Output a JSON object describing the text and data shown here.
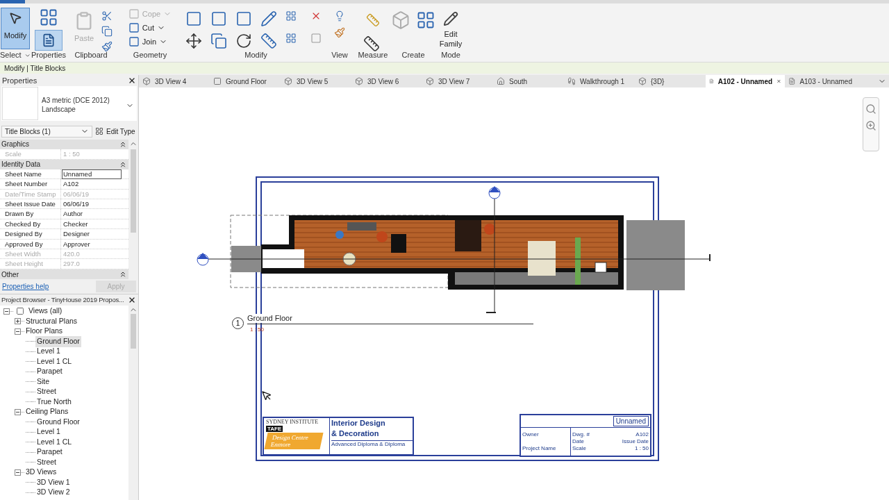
{
  "ribbon": {
    "groups": [
      {
        "label": "Select",
        "dropdown": true,
        "buttons": [
          {
            "label": "Modify",
            "kind": "large",
            "selected": true,
            "disabled": false
          }
        ]
      },
      {
        "label": "Properties"
      },
      {
        "label": "Clipboard",
        "buttons": [
          {
            "label": "Paste",
            "kind": "large",
            "selected": false,
            "disabled": true
          }
        ]
      },
      {
        "label": "Geometry",
        "buttons": [
          {
            "label": "Cope",
            "kind": "small",
            "selected": false,
            "disabled": true
          },
          {
            "label": "Cut",
            "kind": "small",
            "selected": false,
            "disabled": false
          },
          {
            "label": "Join",
            "kind": "small",
            "selected": false,
            "disabled": false
          }
        ]
      },
      {
        "label": "Modify"
      },
      {
        "label": "View"
      },
      {
        "label": "Measure"
      },
      {
        "label": "Create"
      },
      {
        "label": "Mode",
        "buttons": [
          {
            "label": "Edit Family",
            "kind": "large",
            "selected": false,
            "disabled": false
          }
        ]
      }
    ]
  },
  "context_bar": "Modify | Title Blocks",
  "properties": {
    "title": "Properties",
    "type_name": "A3 metric (DCE 2012)",
    "type_detail": "Landscape",
    "filter": "Title Blocks (1)",
    "edit_type": "Edit Type",
    "sections": [
      {
        "name": "Graphics",
        "rows": [
          {
            "label": "Scale",
            "value": "1 : 50",
            "disabled": true,
            "editing": false
          }
        ]
      },
      {
        "name": "Identity Data",
        "rows": [
          {
            "label": "Sheet Name",
            "value": "Unnamed",
            "disabled": false,
            "editing": true
          },
          {
            "label": "Sheet Number",
            "value": "A102",
            "disabled": false,
            "editing": false
          },
          {
            "label": "Date/Time Stamp",
            "value": "06/06/19",
            "disabled": true,
            "editing": false
          },
          {
            "label": "Sheet Issue Date",
            "value": "06/06/19",
            "disabled": false,
            "editing": false
          },
          {
            "label": "Drawn By",
            "value": "Author",
            "disabled": false,
            "editing": false
          },
          {
            "label": "Checked By",
            "value": "Checker",
            "disabled": false,
            "editing": false
          },
          {
            "label": "Designed By",
            "value": "Designer",
            "disabled": false,
            "editing": false
          },
          {
            "label": "Approved By",
            "value": "Approver",
            "disabled": false,
            "editing": false
          },
          {
            "label": "Sheet Width",
            "value": "420.0",
            "disabled": true,
            "editing": false
          },
          {
            "label": "Sheet Height",
            "value": "297.0",
            "disabled": true,
            "editing": false
          }
        ]
      },
      {
        "name": "Other"
      }
    ],
    "help": "Properties help",
    "apply": "Apply"
  },
  "browser": {
    "title": "Project Browser - TinyHouse 2019 Propos...",
    "tree": [
      {
        "label": "Views (all)",
        "expanded": true,
        "selected": false,
        "children": [
          {
            "label": "Structural Plans",
            "expanded": false,
            "selected": false
          },
          {
            "label": "Floor Plans",
            "expanded": true,
            "selected": false,
            "children": [
              {
                "label": "Ground Floor",
                "selected": true
              },
              {
                "label": "Level 1",
                "selected": false
              },
              {
                "label": "Level 1 CL",
                "selected": false
              },
              {
                "label": "Parapet",
                "selected": false
              },
              {
                "label": "Site",
                "selected": false
              },
              {
                "label": "Street",
                "selected": false
              },
              {
                "label": "True North",
                "selected": false
              }
            ]
          },
          {
            "label": "Ceiling Plans",
            "expanded": true,
            "selected": false,
            "children": [
              {
                "label": "Ground Floor",
                "selected": false
              },
              {
                "label": "Level 1",
                "selected": false
              },
              {
                "label": "Level 1 CL",
                "selected": false
              },
              {
                "label": "Parapet",
                "selected": false
              },
              {
                "label": "Street",
                "selected": false
              }
            ]
          },
          {
            "label": "3D Views",
            "expanded": true,
            "selected": false,
            "children": [
              {
                "label": "3D View 1",
                "selected": false
              },
              {
                "label": "3D View 2",
                "selected": false
              }
            ]
          }
        ]
      }
    ]
  },
  "tabs": [
    {
      "label": "3D View 4",
      "kind": "model",
      "selected": false
    },
    {
      "label": "Ground Floor",
      "kind": "plan",
      "selected": false
    },
    {
      "label": "3D View 5",
      "kind": "model",
      "selected": false
    },
    {
      "label": "3D View 6",
      "kind": "model",
      "selected": false
    },
    {
      "label": "3D View 7",
      "kind": "model",
      "selected": false
    },
    {
      "label": "South",
      "kind": "elevation",
      "selected": false
    },
    {
      "label": "Walkthrough 1",
      "kind": "walkthrough",
      "selected": false
    },
    {
      "label": "{3D}",
      "kind": "model",
      "selected": false
    },
    {
      "label": "A102 - Unnamed",
      "kind": "sheet",
      "selected": true
    },
    {
      "label": "A103 - Unnamed",
      "kind": "sheet",
      "selected": false
    }
  ],
  "sheet": {
    "view_number": "1",
    "view_title": "Ground Floor",
    "view_scale": "1 : 50",
    "title_block": {
      "institute": "SYDNEY INSTITUTE",
      "badge": "TAFE",
      "campus": [
        "Design Centre",
        "Enmore"
      ],
      "course": [
        "Interior Design",
        "& Decoration"
      ],
      "award": "Advanced Diploma & Diploma",
      "sheet_name": "Unnamed",
      "owner": "Owner",
      "project": "Project Name",
      "dwg_label": "Dwg. #",
      "dwg_value": "A102",
      "date_label": "Date",
      "scale_label": "Scale",
      "issue_label": "Issue Date",
      "scale_value": "1 : 50"
    }
  }
}
